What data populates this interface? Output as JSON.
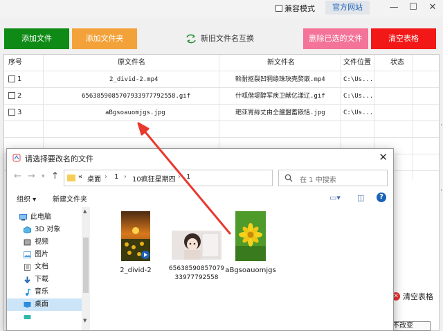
{
  "topbar": {
    "compat_label": "兼容模式",
    "official_site_label": "官方网站",
    "min_glyph": "—",
    "max_glyph": "☐",
    "close_glyph": "✕"
  },
  "actions": {
    "add_file": "添加文件",
    "add_folder": "添加文件夹",
    "swap_names": "新旧文件名互换",
    "delete_selected": "删除已选的文件",
    "clear_table": "清空表格"
  },
  "table": {
    "headers": [
      "序号",
      "原文件名",
      "新文件名",
      "文件位置",
      "状态"
    ],
    "rows": [
      {
        "index": "1",
        "original": "2_divid-2.mp4",
        "new": "斡耐抠裂凹犅绦珠玦壳赘嵌.mp4",
        "location": "C:\\Us...",
        "status": ""
      },
      {
        "index": "2",
        "original": "6563859085707933977792558.gif",
        "new": "什呱偕堤醇军疾卫献亿漾辽.gif",
        "location": "C:\\Us...",
        "status": ""
      },
      {
        "index": "3",
        "original": "aBgsoauomjgs.jpg",
        "new": "耙亚胃絲丈由仝艘盟蓄嵌恬.jpg",
        "location": "C:\\Us...",
        "status": ""
      }
    ]
  },
  "bottom_right": {
    "clear_table_label": "清空表格",
    "partial_text": "不改变"
  },
  "dialog": {
    "title": "请选择要改名的文件",
    "close_glyph": "✕",
    "breadcrumb": [
      "«",
      "桌面",
      "›",
      "1",
      "›",
      "10疯狂星期四",
      "›",
      "1"
    ],
    "search_placeholder": "在 1 中搜索",
    "toolbar": {
      "organize": "组织 ▾",
      "new_folder": "新建文件夹"
    },
    "nav_items": [
      {
        "label": "此电脑",
        "icon": "computer-icon",
        "level": 0,
        "selected": false
      },
      {
        "label": "3D 对象",
        "icon": "3d-objects-icon",
        "level": 1,
        "selected": false
      },
      {
        "label": "视频",
        "icon": "video-folder-icon",
        "level": 1,
        "selected": false
      },
      {
        "label": "图片",
        "icon": "pictures-folder-icon",
        "level": 1,
        "selected": false
      },
      {
        "label": "文档",
        "icon": "documents-folder-icon",
        "level": 1,
        "selected": false
      },
      {
        "label": "下载",
        "icon": "download-icon",
        "level": 1,
        "selected": false
      },
      {
        "label": "音乐",
        "icon": "music-icon",
        "level": 1,
        "selected": false
      },
      {
        "label": "桌面",
        "icon": "desktop-icon",
        "level": 1,
        "selected": true
      }
    ],
    "files": [
      {
        "name": "2_divid-2",
        "kind": "video"
      },
      {
        "name": "6563859085707933977792558",
        "kind": "gif"
      },
      {
        "name": "aBgsoauomjgs",
        "kind": "jpg"
      }
    ]
  },
  "colors": {
    "green_button": "#0f8a16",
    "orange_button": "#f3a23a",
    "pink_button": "#f47399",
    "red_button": "#f21818",
    "arrow": "#e8392f",
    "selection": "#cce4f7"
  }
}
